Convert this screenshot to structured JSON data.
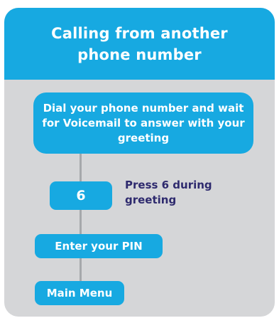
{
  "header": {
    "title": "Calling from another phone number"
  },
  "steps": {
    "dial": "Dial your phone number and wait for Voicemail to answer with your greeting",
    "key": "6",
    "key_note": "Press 6 during greeting",
    "pin": "Enter your PIN",
    "menu": "Main Menu"
  },
  "colors": {
    "accent": "#17a9e1",
    "panel": "#d5d6d8",
    "connector": "#a6a8ab",
    "note_text": "#2e2a6e"
  }
}
